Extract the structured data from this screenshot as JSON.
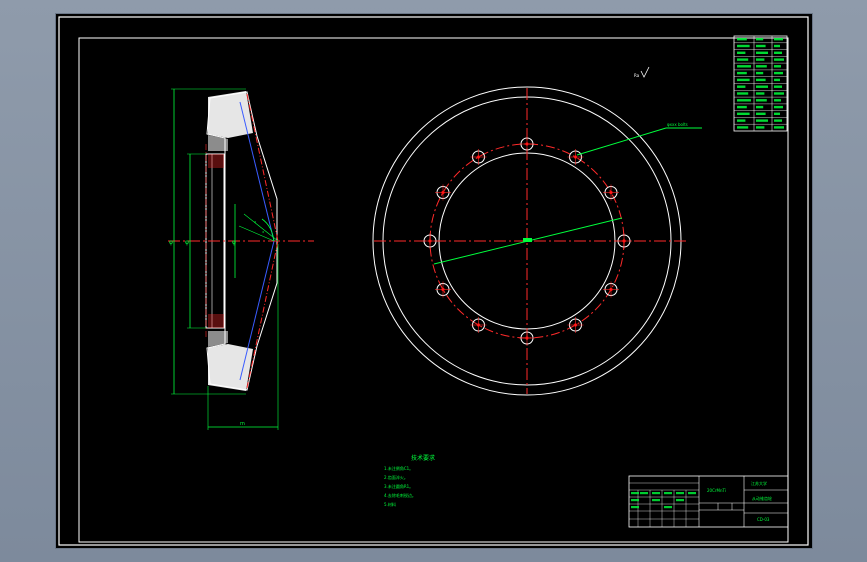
{
  "viewport": {
    "background": "#8f9bab",
    "sheet_background": "#000000"
  },
  "colors": {
    "frame": "#ffffff",
    "outline": "#ffffff",
    "centerline": "#ff2a2a",
    "dimension": "#00ff3c",
    "hidden_line": "#3a5cff",
    "section_fill": "#ffffff",
    "hole_fill": "#ff0000"
  },
  "drawing": {
    "bolt_holes": {
      "count": 12
    },
    "front_view": {
      "leader_label": "φxxx bolts"
    },
    "section_view": {
      "dimension_labels": [
        "φ",
        "φ",
        "φ",
        "m"
      ],
      "angle_labels": [
        "°",
        "°"
      ]
    },
    "roughness_symbol": "Ra",
    "technical_requirements": {
      "title": "技术要求",
      "items": [
        "1.未注倒角C1。",
        "2.齿面淬火。",
        "3.未注圆角R1。",
        "4.去除毛刺锐边。",
        "5.材料"
      ]
    },
    "title_block": {
      "school": "江苏大学",
      "part_name": "从动锥齿轮",
      "drawing_no": "CD-03",
      "material": "20CrMnTi"
    }
  }
}
